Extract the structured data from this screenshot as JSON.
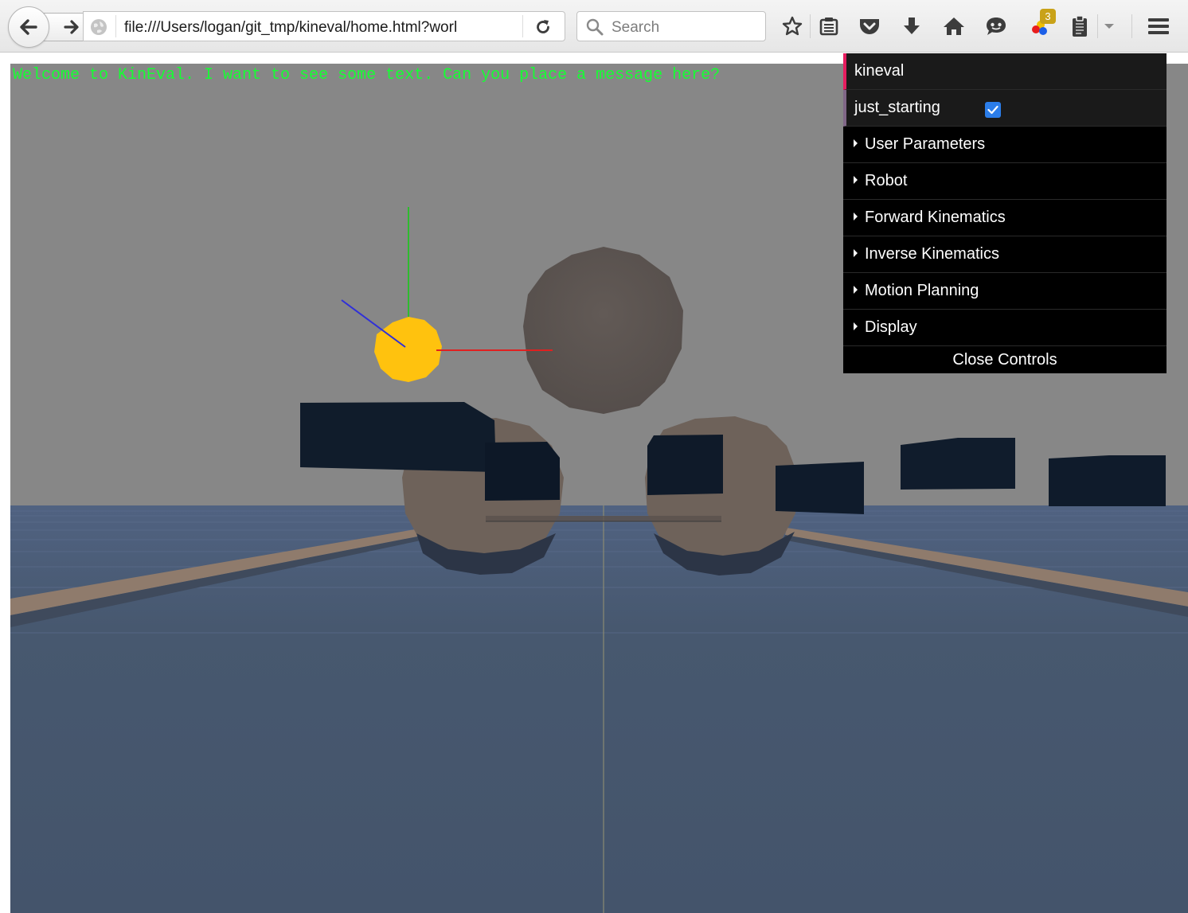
{
  "browser": {
    "url": "file:///Users/logan/git_tmp/kineval/home.html?worl",
    "search_placeholder": "Search",
    "badge_count": "3",
    "icons": [
      "back-arrow-icon",
      "forward-arrow-icon",
      "globe-icon",
      "reload-icon",
      "search-icon",
      "star-icon",
      "reading-list-icon",
      "pocket-icon",
      "download-icon",
      "home-icon",
      "chat-icon",
      "extension-icon",
      "clipboard-icon",
      "chevron-down-icon",
      "hamburger-menu-icon"
    ]
  },
  "scene": {
    "message": "Welcome to KinEval. I want to see some text. Can you place a message here?",
    "message_color": "#16ff33",
    "sky_color": "#878787",
    "floor_color": "#44546b",
    "axis_colors": {
      "x": "#e02020",
      "y": "#2fbb2f",
      "z": "#3030d8"
    },
    "target_color": "#ffc20e"
  },
  "controls": {
    "title": "kineval",
    "checkbox_label": "just_starting",
    "checkbox_checked": true,
    "folders": [
      "User Parameters",
      "Robot",
      "Forward Kinematics",
      "Inverse Kinematics",
      "Motion Planning",
      "Display"
    ],
    "close_label": "Close Controls"
  }
}
